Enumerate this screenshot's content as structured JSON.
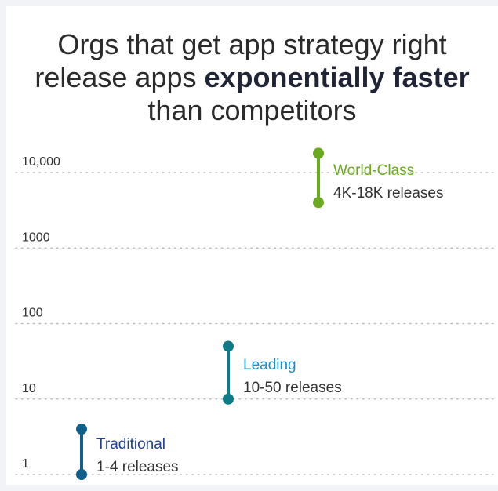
{
  "title": {
    "line1": "Orgs that get app strategy right",
    "line2_pre": "release apps ",
    "line2_bold": "exponentially faster",
    "line3": "than competitors"
  },
  "chart_data": {
    "type": "range",
    "yscale": "log",
    "ylim": [
      1,
      10000
    ],
    "yticks": [
      {
        "value": 1,
        "label": "1"
      },
      {
        "value": 10,
        "label": "10"
      },
      {
        "value": 100,
        "label": "100"
      },
      {
        "value": 1000,
        "label": "1000"
      },
      {
        "value": 10000,
        "label": "10,000"
      }
    ],
    "grid": true,
    "series": [
      {
        "name": "Traditional",
        "description": "1-4 releases",
        "low": 1,
        "high": 4,
        "color": "#0f5f8c",
        "label_color": "#1f3f8f"
      },
      {
        "name": "Leading",
        "description": "10-50 releases",
        "low": 10,
        "high": 50,
        "color": "#0e7c86",
        "label_color": "#1a8fd0"
      },
      {
        "name": "World-Class",
        "description": "4K-18K releases",
        "low": 4000,
        "high": 18000,
        "color": "#6aaa1e",
        "label_color": "#6aaa1e"
      }
    ]
  }
}
